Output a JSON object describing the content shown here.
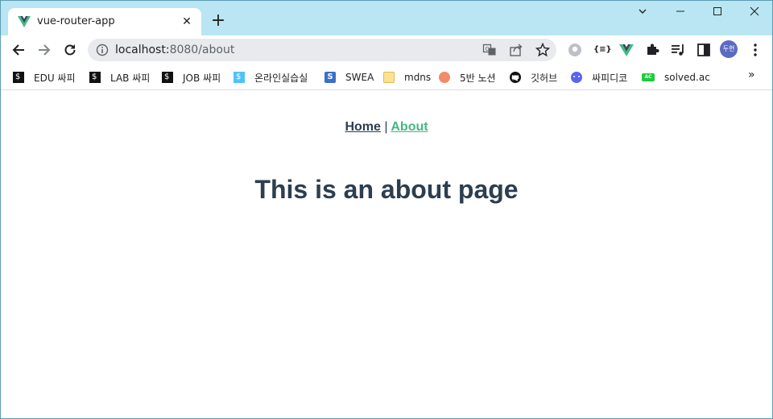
{
  "tab": {
    "title": "vue-router-app"
  },
  "address": {
    "host": "localhost:",
    "port_path": "8080/about"
  },
  "bookmarks": [
    {
      "label": "EDU 싸피",
      "icon": "ssafy-icon"
    },
    {
      "label": "LAB 싸피",
      "icon": "ssafy-icon"
    },
    {
      "label": "JOB 싸피",
      "icon": "ssafy-icon"
    },
    {
      "label": "온라인실습실",
      "icon": "ssafy-icon"
    },
    {
      "label": "SWEA",
      "icon": "swea-icon"
    },
    {
      "label": "mdns",
      "icon": "folder-icon"
    },
    {
      "label": "5반 노션",
      "icon": "peach-icon"
    },
    {
      "label": "깃허브",
      "icon": "github-icon"
    },
    {
      "label": "싸피디코",
      "icon": "discord-icon"
    },
    {
      "label": "solved.ac",
      "icon": "solvedac-icon"
    }
  ],
  "profile": {
    "initials": "두현"
  },
  "page": {
    "nav_home": "Home",
    "nav_separator": "|",
    "nav_about": "About",
    "heading": "This is an about page"
  },
  "colors": {
    "vue_green": "#42b983",
    "text_dark": "#2c3e50",
    "titlebar": "#b9e6f2"
  }
}
